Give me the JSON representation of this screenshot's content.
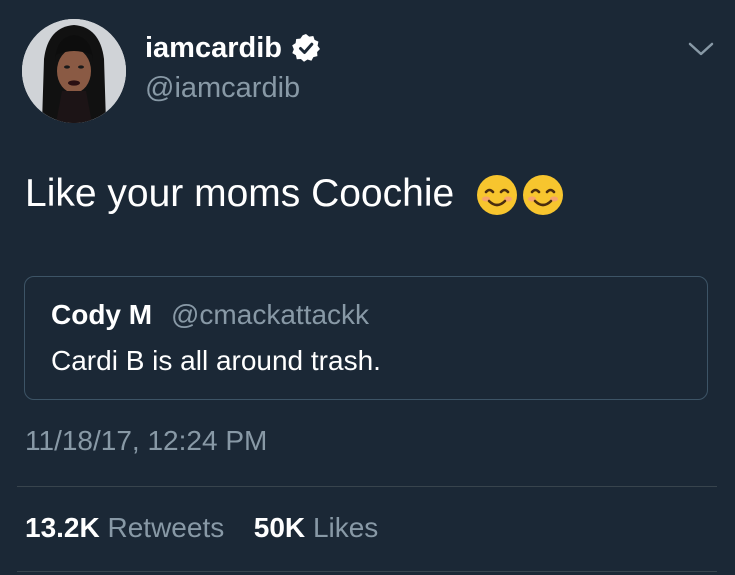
{
  "tweet": {
    "display_name": "iamcardib",
    "handle": "@iamcardib",
    "text": "Like your moms Coochie",
    "emoji": "smiling-face-with-smiling-eyes x2",
    "timestamp": "11/18/17, 12:24 PM"
  },
  "quoted_tweet": {
    "display_name": "Cody M",
    "handle": "@cmackattackk",
    "text": "Cardi B is all around trash."
  },
  "stats": {
    "retweets_count": "13.2K",
    "retweets_label": "Retweets",
    "likes_count": "50K",
    "likes_label": "Likes"
  },
  "icons": {
    "verified": "verified-badge-icon",
    "menu": "chevron-down-icon"
  },
  "colors": {
    "background": "#1b2836",
    "text": "#ffffff",
    "muted": "#8899a6",
    "border": "#3d5466",
    "emoji_face": "#f7c52e"
  }
}
